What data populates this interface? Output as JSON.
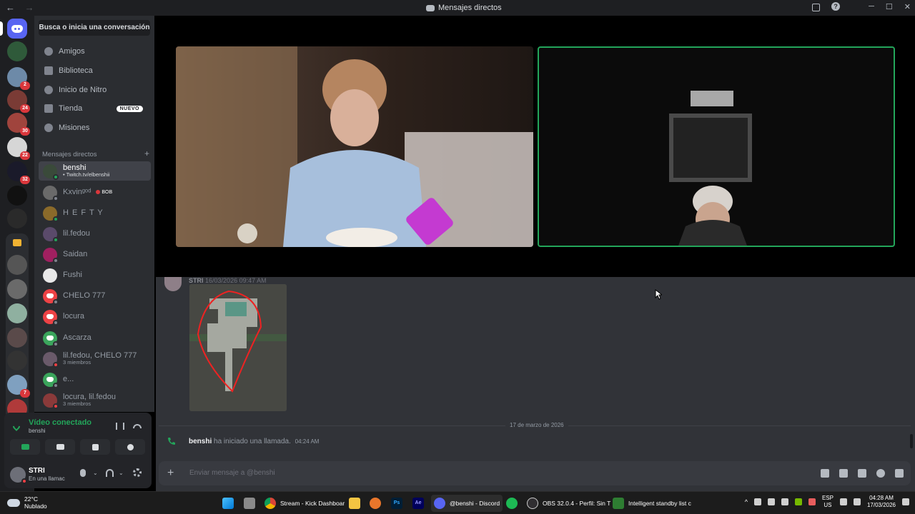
{
  "window": {
    "title": "Mensajes directos",
    "back": "←",
    "forward": "→",
    "minimize": "─",
    "maximize": "☐",
    "close": "✕",
    "help": "?"
  },
  "servers": {
    "badges": [
      "2",
      "24",
      "30",
      "22",
      "32",
      "7",
      "22"
    ]
  },
  "sidebar": {
    "search": "Busca o inicia una conversación",
    "nav": [
      {
        "label": "Amigos"
      },
      {
        "label": "Biblioteca"
      },
      {
        "label": "Inicio de Nitro"
      },
      {
        "label": "Tienda",
        "pill": "NUEVO"
      },
      {
        "label": "Misiones"
      }
    ],
    "dm_header": "Mensajes directos",
    "dm_plus": "+",
    "dms": [
      {
        "name": "benshi",
        "sub": "• Twitch.tv/elbenshii"
      },
      {
        "name": "Kxvinᵍᵒᵈ",
        "tag": "BOB"
      },
      {
        "name": "H E F T Y"
      },
      {
        "name": "lil.fedou"
      },
      {
        "name": "Saidan"
      },
      {
        "name": "Fushi"
      },
      {
        "name": "CHELO 777"
      },
      {
        "name": "locura"
      },
      {
        "name": "Ascarza"
      },
      {
        "name": "lil.fedou, CHELO 777",
        "sub": "3 miembros"
      },
      {
        "name": "e..."
      },
      {
        "name": "locura, lil.fedou",
        "sub": "3 miembros"
      }
    ]
  },
  "voice": {
    "title": "Vídeo conectado",
    "channel": "benshi",
    "user": {
      "name": "STRI",
      "status": "En una llamac"
    }
  },
  "chat": {
    "msg_author": "STRI",
    "msg_time": "16/03/2026 09:47 AM",
    "date_divider": "17 de marzo de 2026",
    "call_user": "benshi",
    "call_text": "ha iniciado una llamada.",
    "call_time": "04:24 AM",
    "input_placeholder": "Enviar mensaje a @benshi",
    "input_plus": "+"
  },
  "taskbar": {
    "temp": "22°C",
    "weather": "Nublado",
    "apps": [
      {
        "label": "Stream - Kick Dashboar"
      },
      {
        "label": "Ps"
      },
      {
        "label": "Ae"
      },
      {
        "label": "@benshi - Discord"
      },
      {
        "label": "OBS 32.0.4 - Perfil: Sin T"
      },
      {
        "label": "Intelligent standby list c"
      }
    ],
    "lang1": "ESP",
    "lang2": "US",
    "time": "04:28 AM",
    "date": "17/03/2026",
    "chevron": "^"
  },
  "colors": {
    "discord_blurple": "#5865f2",
    "online_green": "#23a55a",
    "dnd_red": "#f23f43",
    "badge_red": "#da373c"
  }
}
